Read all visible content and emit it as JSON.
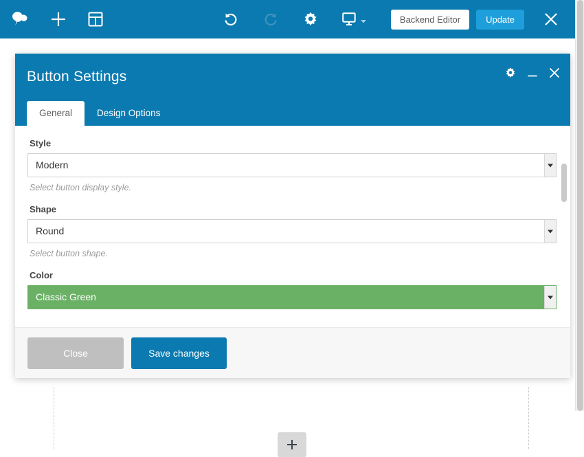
{
  "toolbar": {
    "logo_icon": "wpbakery-cloud-logo-icon",
    "add_element_icon": "plus-icon",
    "templates_icon": "layout-templates-icon",
    "undo_icon": "undo-arrow-icon",
    "redo_icon": "redo-arrow-icon",
    "settings_icon": "gear-icon",
    "responsive_icon": "monitor-icon",
    "responsive_caret_icon": "chevron-down-icon",
    "backend_editor_label": "Backend Editor",
    "update_label": "Update",
    "close_icon": "close-x-icon"
  },
  "modal": {
    "title": "Button Settings",
    "header_gear_icon": "gear-icon",
    "header_minimize_icon": "minimize-icon",
    "header_close_icon": "close-x-icon",
    "tabs": [
      {
        "label": "General",
        "active": true
      },
      {
        "label": "Design Options",
        "active": false
      }
    ],
    "fields": [
      {
        "label": "Style",
        "value": "Modern",
        "description": "Select button display style.",
        "variant": "default"
      },
      {
        "label": "Shape",
        "value": "Round",
        "description": "Select button shape.",
        "variant": "default"
      },
      {
        "label": "Color",
        "value": "Classic Green",
        "description": "",
        "variant": "green"
      }
    ],
    "footer": {
      "close_label": "Close",
      "save_label": "Save changes"
    }
  },
  "canvas": {
    "add_element_icon": "plus-icon"
  },
  "colors": {
    "toolbar_blue": "#0b7ab0",
    "update_blue": "#1e9fdb",
    "classic_green": "#6ab165",
    "close_gray": "#bfbfbf",
    "save_blue": "#0b7ab0"
  }
}
